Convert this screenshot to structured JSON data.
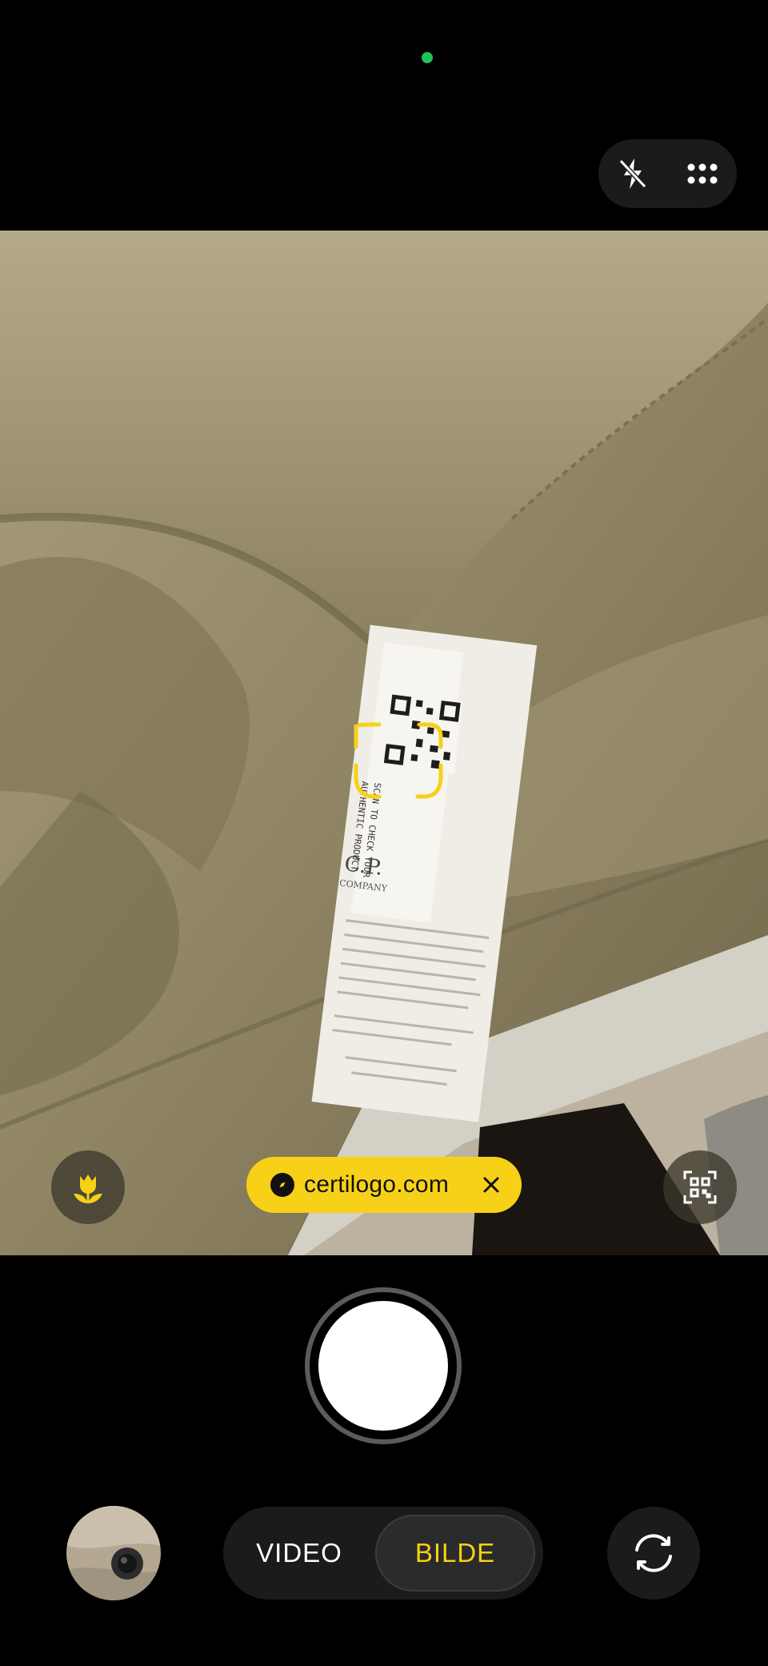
{
  "status": {
    "privacy_dot_color": "#1ec45a"
  },
  "top_controls": {
    "flash_icon": "flash-off-icon",
    "settings_icon": "grid-dots-icon"
  },
  "viewfinder": {
    "subject": "garment care label with QR code",
    "label_brand_text": "C.P.",
    "label_brand_sub": "COMPANY",
    "label_scan_text_1": "SCAN TO CHECK YOUR",
    "label_scan_text_2": "AUTHENTIC PRODUCT"
  },
  "qr_chip": {
    "url": "certilogo.com",
    "icon": "compass-icon",
    "close_icon": "close-icon"
  },
  "macro_button": {
    "icon": "tulip-macro-icon"
  },
  "scan_button": {
    "icon": "qr-scan-icon"
  },
  "modes": [
    {
      "label": "VIDEO"
    },
    {
      "label": "BILDE"
    }
  ],
  "active_mode": "BILDE",
  "colors": {
    "accent": "#f7d117",
    "background": "#000000",
    "chip_bg": "#f7d117"
  }
}
